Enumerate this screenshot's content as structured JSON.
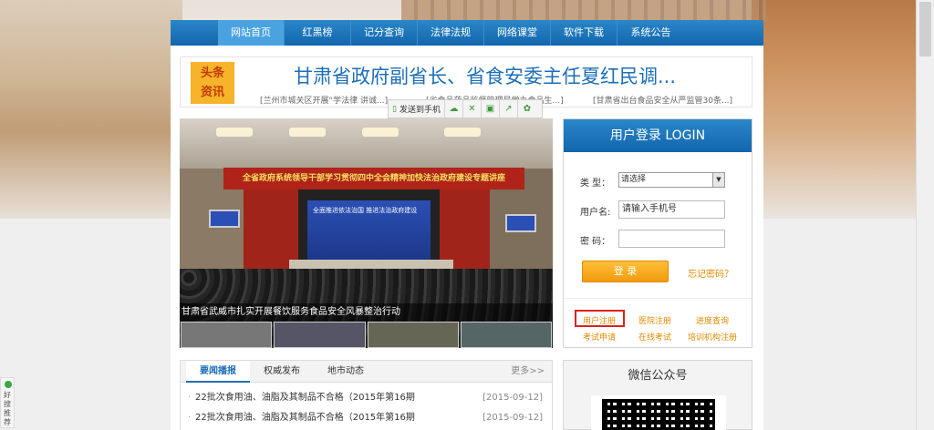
{
  "nav": {
    "items": [
      "网站首页",
      "红黑榜",
      "记分查询",
      "法律法规",
      "网络课堂",
      "软件下载",
      "系统公告"
    ]
  },
  "headline": {
    "badge_line1": "头条",
    "badge_line2": "资讯",
    "title": "甘肃省政府副省长、省食安委主任夏红民调...",
    "sub_links": [
      "[兰州市城关区开展“学法律 讲诚...]",
      "[省食品药品监督管理局党办食品生...]",
      "[甘肃省出台食品安全从严监管30条...]"
    ]
  },
  "share_toolbar": {
    "send_label": "发送到手机"
  },
  "photo": {
    "banner": "全省政府系统领导干部学习贯彻四中全会精神加快法治政府建设专题讲座",
    "screen_text": "全面推进依法治国 推进法治政府建设",
    "caption": "甘肃省武威市扎实开展餐饮服务食品安全风暴整治行动"
  },
  "news": {
    "tabs": [
      "要闻播报",
      "权威发布",
      "地市动态"
    ],
    "more": "更多>>",
    "rows": [
      {
        "title": "22批次食用油、油脂及其制品不合格（2015年第16期",
        "date": "[2015-09-12]"
      },
      {
        "title": "22批次食用油、油脂及其制品不合格（2015年第16期",
        "date": "[2015-09-12]"
      }
    ]
  },
  "login": {
    "title": "用户登录 LOGIN",
    "type_label": "类 型：",
    "type_value": "请选择",
    "user_label": "用户名:",
    "user_value": "请输入手机号",
    "pwd_label": "密  码：",
    "login_button": "登 录",
    "forgot": "忘记密码？",
    "links_row1": [
      "用户注册",
      "医院注册",
      "进度查询"
    ],
    "links_row2": [
      "考试申请",
      "在线考试",
      "培训机构注册"
    ]
  },
  "wechat": {
    "title": "微信公众号"
  },
  "side_widget": {
    "label": "好搜推荐"
  },
  "colors": {
    "nav_blue": "#1266ad",
    "headline_blue": "#1c6fb8",
    "accent_orange": "#f19b0c",
    "highlight_red": "#d9241c"
  }
}
